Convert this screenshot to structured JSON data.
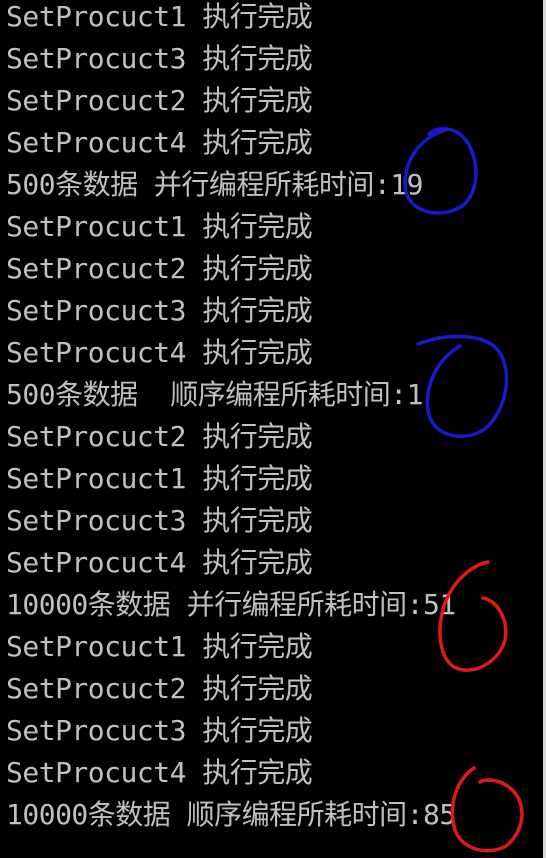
{
  "console": {
    "lines": [
      "SetProcuct1 执行完成",
      "SetProcuct3 执行完成",
      "SetProcuct2 执行完成",
      "SetProcuct4 执行完成",
      "500条数据 并行编程所耗时间:19",
      "SetProcuct1 执行完成",
      "SetProcuct2 执行完成",
      "SetProcuct3 执行完成",
      "SetProcuct4 执行完成",
      "500条数据  顺序编程所耗时间:1",
      "SetProcuct2 执行完成",
      "SetProcuct1 执行完成",
      "SetProcuct3 执行完成",
      "SetProcuct4 执行完成",
      "10000条数据 并行编程所耗时间:51",
      "SetProcuct1 执行完成",
      "SetProcuct2 执行完成",
      "SetProcuct3 执行完成",
      "SetProcuct4 执行完成",
      "10000条数据 顺序编程所耗时间:85"
    ]
  },
  "colors": {
    "background": "#000000",
    "text": "#c0c0c0",
    "annotation_blue": "#1a1acc",
    "annotation_red": "#e01818"
  },
  "annotations": [
    {
      "shape": "circle",
      "color": "blue",
      "marks": "500条数据 并行编程所耗时间:19"
    },
    {
      "shape": "circle",
      "color": "blue",
      "marks": "500条数据  顺序编程所耗时间:1"
    },
    {
      "shape": "circle",
      "color": "red",
      "marks": "10000条数据 并行编程所耗时间:51"
    },
    {
      "shape": "circle",
      "color": "red",
      "marks": "10000条数据 顺序编程所耗时间:85"
    }
  ]
}
